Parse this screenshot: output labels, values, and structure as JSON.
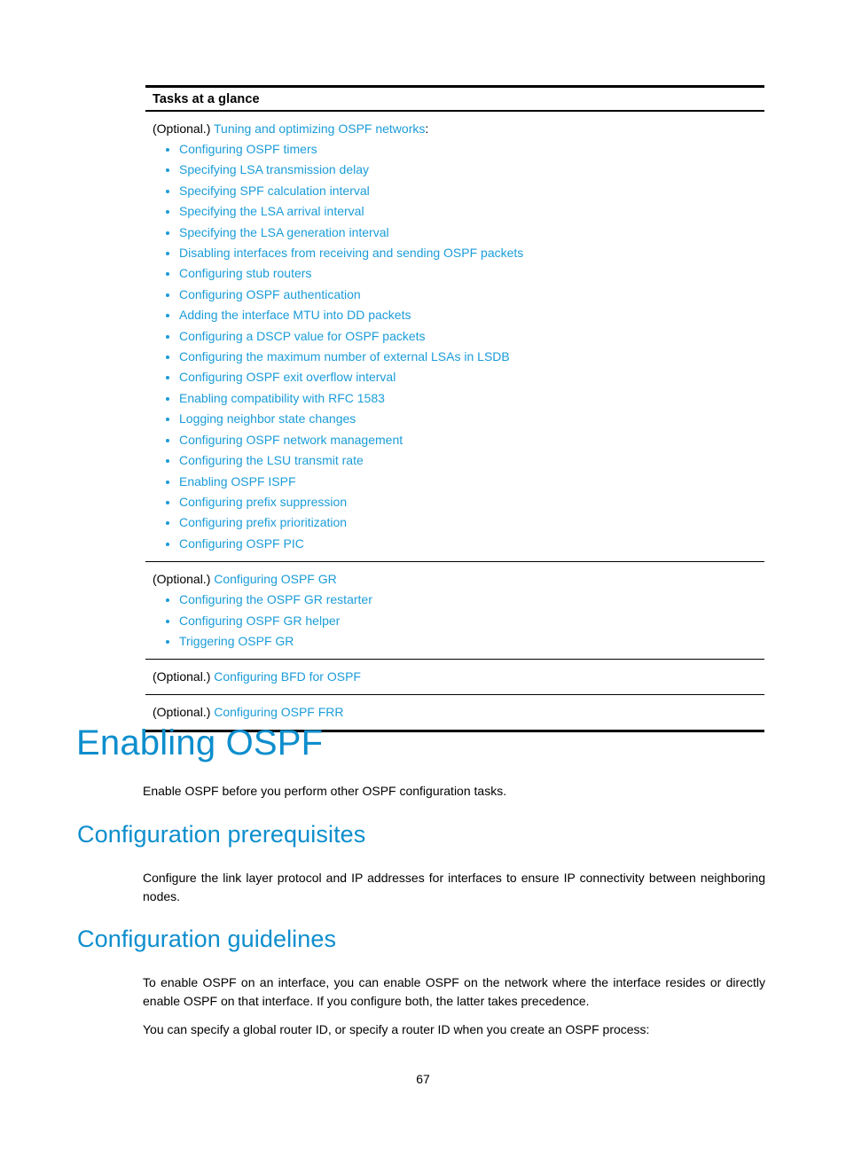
{
  "table": {
    "header": "Tasks at a glance",
    "rows": [
      {
        "lead_prefix": "(Optional.) ",
        "lead_link": "Tuning and optimizing OSPF networks",
        "lead_suffix": ":",
        "items": [
          "Configuring OSPF timers",
          "Specifying LSA transmission delay",
          "Specifying SPF calculation interval",
          "Specifying the LSA arrival interval",
          "Specifying the LSA generation interval",
          "Disabling interfaces from receiving and sending OSPF packets",
          "Configuring stub routers",
          "Configuring OSPF authentication",
          "Adding the interface MTU into DD packets",
          "Configuring a DSCP value for OSPF packets",
          "Configuring the maximum number of external LSAs in LSDB",
          "Configuring OSPF exit overflow interval",
          "Enabling compatibility with RFC 1583",
          "Logging neighbor state changes",
          "Configuring OSPF network management",
          "Configuring the LSU transmit rate",
          "Enabling OSPF ISPF",
          "Configuring prefix suppression",
          "Configuring prefix prioritization",
          "Configuring OSPF PIC"
        ]
      },
      {
        "lead_prefix": "(Optional.) ",
        "lead_link": "Configuring OSPF GR",
        "lead_suffix": "",
        "items": [
          "Configuring the OSPF GR restarter",
          "Configuring OSPF GR helper",
          "Triggering OSPF GR"
        ]
      },
      {
        "lead_prefix": "(Optional.) ",
        "lead_link": "Configuring BFD for OSPF",
        "lead_suffix": "",
        "items": []
      },
      {
        "lead_prefix": "(Optional.) ",
        "lead_link": "Configuring OSPF FRR",
        "lead_suffix": "",
        "items": []
      }
    ]
  },
  "sections": {
    "enabling_ospf": {
      "heading": "Enabling OSPF",
      "paragraph": "Enable OSPF before you perform other OSPF configuration tasks."
    },
    "configuration_prerequisites": {
      "heading": "Configuration prerequisites",
      "paragraph": "Configure the link layer protocol and IP addresses for interfaces to ensure IP connectivity between neighboring nodes."
    },
    "configuration_guidelines": {
      "heading": "Configuration guidelines",
      "paragraph_1": "To enable OSPF on an interface, you can enable OSPF on the network where the interface resides or directly enable OSPF on that interface. If you configure both, the latter takes precedence.",
      "paragraph_2": "You can specify a global router ID, or specify a router ID when you create an OSPF process:"
    }
  },
  "footer": {
    "page_number": "67"
  },
  "colors": {
    "link": "#1b9cd8",
    "heading": "#0d8ecd",
    "text": "#000000",
    "rule": "#000000"
  }
}
